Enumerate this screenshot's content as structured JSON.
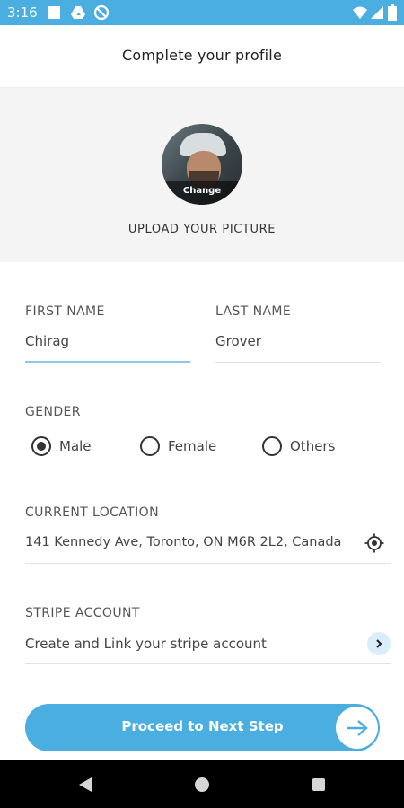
{
  "status_bar": {
    "time": "3:16",
    "left_icons": [
      "square-icon",
      "drive-icon",
      "no-sync-icon"
    ],
    "right_icons": [
      "wifi-icon",
      "signal-icon",
      "battery-icon"
    ]
  },
  "header": {
    "title": "Complete your profile"
  },
  "avatar": {
    "change_label": "Change",
    "upload_label": "UPLOAD YOUR PICTURE"
  },
  "form": {
    "first_name": {
      "label": "FIRST NAME",
      "value": "Chirag"
    },
    "last_name": {
      "label": "LAST NAME",
      "value": "Grover"
    },
    "gender": {
      "label": "GENDER",
      "options": [
        "Male",
        "Female",
        "Others"
      ],
      "selected": "Male"
    },
    "location": {
      "label": "CURRENT LOCATION",
      "value": "141 Kennedy Ave, Toronto, ON M6R 2L2, Canada"
    },
    "stripe": {
      "label": "STRIPE ACCOUNT",
      "value": "Create and Link your stripe account"
    }
  },
  "cta": {
    "label": "Proceed to Next Step"
  },
  "colors": {
    "accent": "#4aaee0",
    "accent_light": "#d9eef9",
    "active_underline": "#8cc8ea"
  }
}
